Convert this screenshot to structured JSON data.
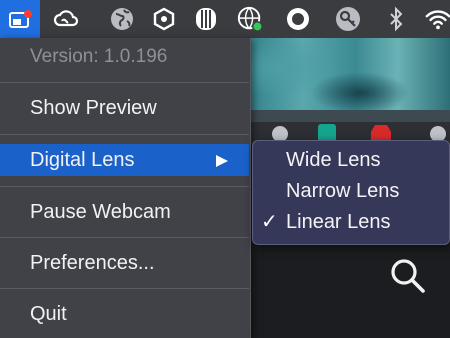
{
  "menubar": {
    "icons": [
      "app-icon",
      "creative-cloud-icon",
      "globe-icon",
      "hexagon-network-icon",
      "server-bars-icon",
      "globe-badge-icon",
      "ring-icon",
      "key-icon",
      "bluetooth-icon",
      "wifi-icon"
    ]
  },
  "menu": {
    "version": "Version: 1.0.196",
    "items": [
      {
        "label": "Show Preview"
      },
      {
        "label": "Digital Lens"
      },
      {
        "label": "Pause Webcam"
      },
      {
        "label": "Preferences..."
      },
      {
        "label": "Quit"
      }
    ]
  },
  "submenu": {
    "items": [
      {
        "label": "Wide Lens",
        "checked": false
      },
      {
        "label": "Narrow Lens",
        "checked": false
      },
      {
        "label": "Linear Lens",
        "checked": true
      }
    ],
    "check_mark": "✓"
  },
  "colors": {
    "accent": "#1a62c9",
    "menu_bg": "#404248",
    "submenu_bg": "#36385a"
  }
}
